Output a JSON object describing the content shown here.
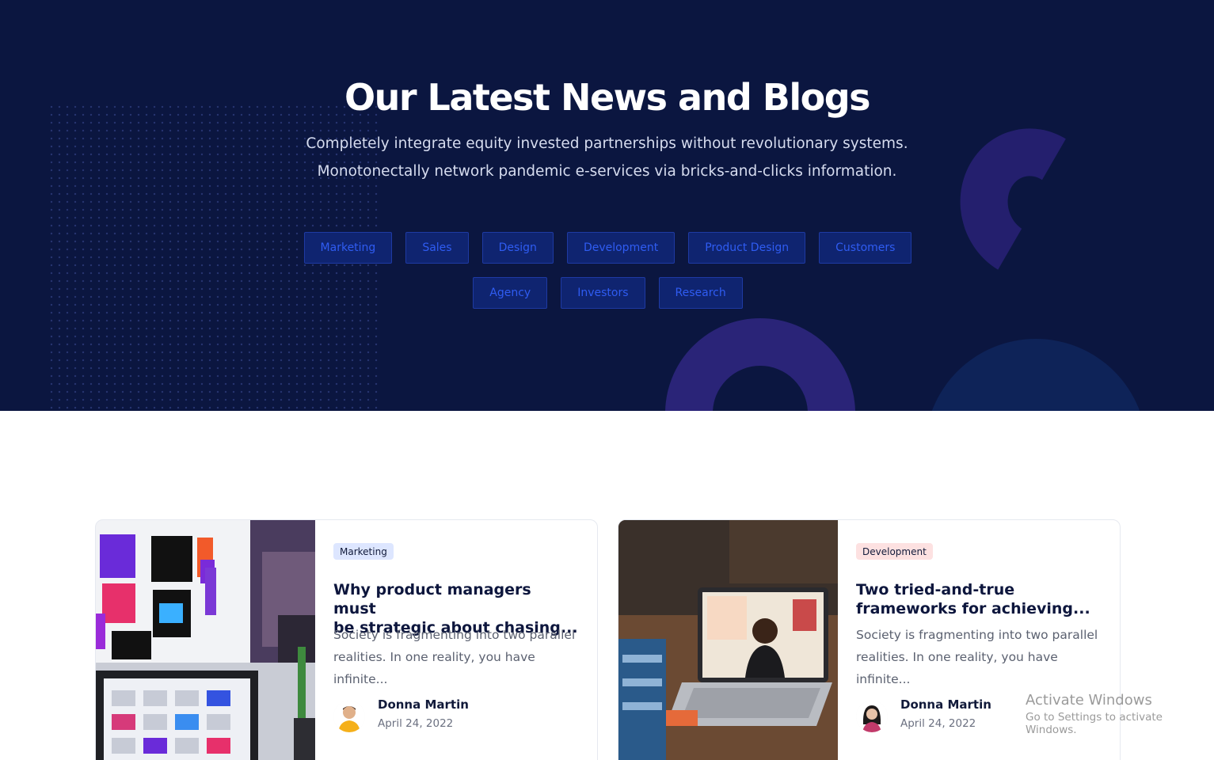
{
  "hero": {
    "title": "Our Latest News and Blogs",
    "subtitle_line1": "Completely integrate equity invested partnerships without revolutionary systems.",
    "subtitle_line2": "Monotonectally network pandemic e-services via bricks-and-clicks information.",
    "tags": [
      "Marketing",
      "Sales",
      "Design",
      "Development",
      "Product Design",
      "Customers",
      "Agency",
      "Investors",
      "Research"
    ]
  },
  "posts": [
    {
      "category": "Marketing",
      "title_line1": "Why product managers must",
      "title_line2": "be strategic about chasing...",
      "excerpt_line1": "Society is fragmenting into two parallel",
      "excerpt_line2": "realities. In one reality, you have infinite...",
      "author": "Donna Martin",
      "date": "April 24, 2022"
    },
    {
      "category": "Development",
      "title_line1": "Two tried-and-true",
      "title_line2": "frameworks for achieving...",
      "excerpt_line1": "Society is fragmenting into two parallel",
      "excerpt_line2": "realities. In one reality, you have infinite...",
      "author": "Donna Martin",
      "date": "April 24, 2022"
    }
  ],
  "watermark": {
    "line1": "Activate Windows",
    "line2": "Go to Settings to activate Windows."
  },
  "colors": {
    "hero_bg": "#0b1640",
    "tag_text": "#2f5cf2",
    "tag_bg": "#0f2470",
    "heading_dark": "#0d163d"
  }
}
